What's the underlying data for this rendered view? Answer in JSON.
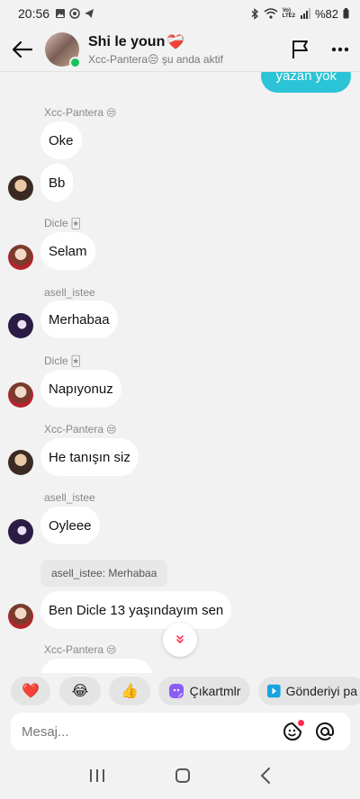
{
  "status": {
    "time": "20:56",
    "battery": "%82",
    "network": "VoLTE2"
  },
  "header": {
    "title": "Shi le youn",
    "title_emoji": "❤️‍🩹",
    "subtitle": "Xcc-Pantera😒 şu anda aktif"
  },
  "outgoing_partial": "yazan yok",
  "messages": [
    {
      "sender": "Xcc-Pantera",
      "sender_emoji": "😒",
      "text": "Oke"
    },
    {
      "text": "Bb"
    },
    {
      "sender": "Dicle",
      "sender_emoji": "🃏",
      "text": "Selam"
    },
    {
      "sender": "asell_istee",
      "text": "Merhabaa"
    },
    {
      "sender": "Dicle",
      "sender_emoji": "🃏",
      "text": "Napıyonuz"
    },
    {
      "sender": "Xcc-Pantera",
      "sender_emoji": "😒",
      "text": "He tanışın siz"
    },
    {
      "sender": "asell_istee",
      "text": "Oyleee"
    },
    {
      "reply_preview": "asell_istee: Merhabaa",
      "text": "Ben Dicle 13 yaşındayım sen"
    },
    {
      "sender": "Xcc-Pantera",
      "sender_emoji": "😒"
    }
  ],
  "quick_actions": {
    "heart": "❤️",
    "laugh": "😂",
    "thumbs": "👍",
    "stickers": "Çıkartmlr",
    "send_post": "Gönderiyi pa"
  },
  "input": {
    "placeholder": "Mesaj..."
  }
}
